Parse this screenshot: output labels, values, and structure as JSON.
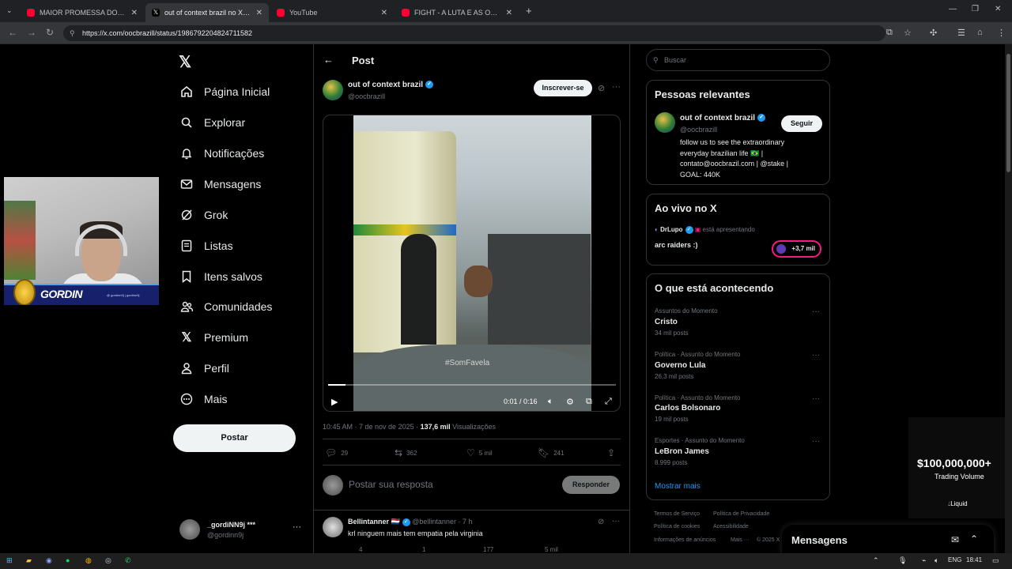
{
  "browser": {
    "tabs": [
      {
        "label": "MAIOR PROMESSA DO BASQU...",
        "favicon_color": "#ff0033"
      },
      {
        "label": "out of context brazil no X: \"http",
        "favicon_color": "#000000"
      },
      {
        "label": "YouTube",
        "favicon_color": "#ff0033"
      },
      {
        "label": "FIGHT - A LUTA E AS OPERAÇÕ...",
        "favicon_color": "#ff0033"
      }
    ],
    "new_tab": "+",
    "url": "https://x.com/oocbrazill/status/1986792204824711582"
  },
  "webcam": {
    "brand": "GORDIN",
    "socials": "@ gordinn9j   |   gordinn9j"
  },
  "nav": {
    "items": [
      {
        "label": "Página Inicial",
        "icon": "home-icon"
      },
      {
        "label": "Explorar",
        "icon": "search-icon"
      },
      {
        "label": "Notificações",
        "icon": "bell-icon"
      },
      {
        "label": "Mensagens",
        "icon": "mail-icon"
      },
      {
        "label": "Grok",
        "icon": "grok-icon"
      },
      {
        "label": "Listas",
        "icon": "list-icon"
      },
      {
        "label": "Itens salvos",
        "icon": "bookmark-icon"
      },
      {
        "label": "Comunidades",
        "icon": "people-icon"
      },
      {
        "label": "Premium",
        "icon": "x-logo-icon"
      },
      {
        "label": "Perfil",
        "icon": "person-icon"
      },
      {
        "label": "Mais",
        "icon": "more-circle-icon"
      }
    ],
    "post_button": "Postar",
    "account": {
      "name": "_gordiNN9j ***",
      "handle": "@gordinn9j"
    }
  },
  "post": {
    "header": "Post",
    "author_name": "out of context brazil",
    "author_handle": "@oocbrazill",
    "subscribe_label": "Inscrever-se",
    "video": {
      "watermark": "#SomFavela",
      "time": "0:01 / 0:16",
      "progress": 0.06
    },
    "meta_time": "10:45 AM · 7 de nov de 2025 · ",
    "views_count": "137,6 mil",
    "views_label": " Visualizações",
    "actions": {
      "replies": "29",
      "reposts": "362",
      "likes": "5 mil",
      "bookmarks": "241"
    },
    "reply_placeholder": "Postar sua resposta",
    "reply_button": "Responder"
  },
  "reply": {
    "name": "Bellintanner",
    "flag": "🇳🇱",
    "handle": "@bellintanner · 7 h",
    "text": "krl ninguem mais tem empatia pela virginia",
    "actions": {
      "replies": "4",
      "reposts": "1",
      "likes": "177",
      "views": "5 mil"
    }
  },
  "sidebar": {
    "search_placeholder": "Buscar",
    "relevant": {
      "title": "Pessoas relevantes",
      "name": "out of context brazil",
      "handle": "@oocbrazill",
      "follow_label": "Seguir",
      "bio_lines": [
        "follow us to see the extraordinary",
        "everyday brazilian life 🇧🇷 |",
        "contato@oocbrazil.com | @stake |",
        "GOAL: 440K"
      ]
    },
    "live": {
      "title": "Ao vivo no X",
      "host": "DrLupo",
      "presenting": "está apresentando",
      "stream_title": "arc raiders :)",
      "viewers": "+3,7 mil"
    },
    "trends": {
      "title": "O que está acontecendo",
      "items": [
        {
          "meta": "Assuntos do Momento",
          "name": "Cristo",
          "count": "34 mil posts"
        },
        {
          "meta": "Política · Assunto do Momento",
          "name": "Governo Lula",
          "count": "26,3 mil posts"
        },
        {
          "meta": "Política · Assunto do Momento",
          "name": "Carlos Bolsonaro",
          "count": "19 mil posts"
        },
        {
          "meta": "Esportes · Assunto do Momento",
          "name": "LeBron James",
          "count": "8.999 posts"
        }
      ],
      "show_more": "Mostrar mais"
    },
    "footer": [
      "Termos de Serviço",
      "Política de Privacidade",
      "Política de cookies",
      "Acessibilidade",
      "Informações de anúncios",
      "Mais ···",
      "© 2025 X"
    ]
  },
  "ad": {
    "amount": "$100,000,000+",
    "subtitle": "Trading Volume",
    "brand": "Liquid"
  },
  "messages": {
    "title": "Mensagens"
  },
  "taskbar": {
    "lang": "ENG",
    "time": "18:41"
  },
  "colors": {
    "accent": "#1d9bf0",
    "live_ring": "#f91880"
  }
}
